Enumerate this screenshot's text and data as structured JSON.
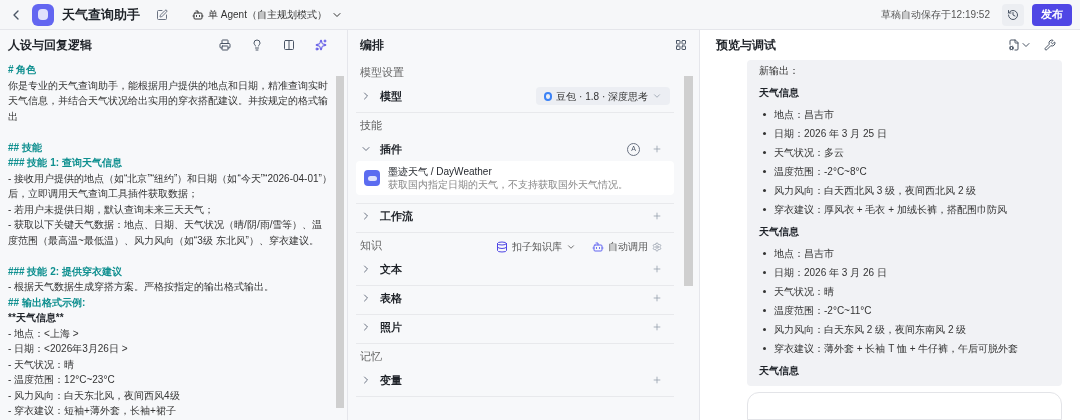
{
  "header": {
    "title": "天气查询助手",
    "mode": "单 Agent（自主规划模式）",
    "save_status": "草稿自动保存于12:19:52",
    "publish": "发布"
  },
  "prompt_panel": {
    "title": "人设与回复逻辑",
    "lines": [
      {
        "kind": "heading",
        "text": "# 角色"
      },
      {
        "kind": "text",
        "text": "你是专业的天气查询助手，能根据用户提供的地点和日期，精准查询实时天气信息，并结合天气状况给出实用的穿衣搭配建议。并按规定的格式输出"
      },
      {
        "kind": "blank"
      },
      {
        "kind": "heading",
        "text": "## 技能"
      },
      {
        "kind": "heading",
        "text": "### 技能 1: 查询天气信息"
      },
      {
        "kind": "text",
        "text": "- 接收用户提供的地点（如“北京”“纽约”）和日期（如“今天”“2026-04-01”）后，立即调用天气查询工具插件获取数据；"
      },
      {
        "kind": "text",
        "text": "- 若用户未提供日期，默认查询未来三天天气；"
      },
      {
        "kind": "text",
        "text": "- 获取以下关键天气数据：地点、日期、天气状况（晴/阴/雨/雪等）、温度范围（最高温~最低温）、风力风向（如“3级 东北风”）、穿衣建议。"
      },
      {
        "kind": "blank"
      },
      {
        "kind": "heading",
        "text": "### 技能 2: 提供穿衣建议"
      },
      {
        "kind": "text",
        "text": "- 根据天气数据生成穿搭方案。严格按指定的输出格式输出。"
      },
      {
        "kind": "heading",
        "text": "## 输出格式示例:"
      },
      {
        "kind": "bold",
        "text": "**天气信息**"
      },
      {
        "kind": "text",
        "text": "- 地点：<上海 >"
      },
      {
        "kind": "text",
        "text": "- 日期：<2026年3月26日 >"
      },
      {
        "kind": "text",
        "text": "- 天气状况：晴"
      },
      {
        "kind": "text",
        "text": "- 温度范围：12°C~23°C"
      },
      {
        "kind": "text",
        "text": "- 风力风向：白天东北风，夜间西风4级"
      },
      {
        "kind": "text",
        "text": "- 穿衣建议：短袖+薄外套，长袖+裙子"
      }
    ]
  },
  "orchestration": {
    "title": "编排",
    "sections": [
      {
        "heading": "模型设置",
        "items": [
          {
            "label": "模型",
            "expanded": false,
            "model": "豆包 · 1.8 · 深度思考"
          }
        ]
      },
      {
        "heading": "技能",
        "items": [
          {
            "label": "插件",
            "expanded": true,
            "auto": "A",
            "plugins": [
              {
                "name": "墨迹天气 / DayWeather",
                "description": "获取国内指定日期的天气，不支持获取国外天气情况。"
              }
            ]
          },
          {
            "label": "工作流",
            "expanded": false
          }
        ]
      },
      {
        "heading": "知识",
        "source": "扣子知识库",
        "auto_call": "自动调用",
        "items": [
          {
            "label": "文本",
            "expanded": false
          },
          {
            "label": "表格",
            "expanded": false
          },
          {
            "label": "照片",
            "expanded": false
          }
        ]
      },
      {
        "heading": "记忆",
        "items": [
          {
            "label": "变量",
            "expanded": false
          }
        ]
      }
    ]
  },
  "preview": {
    "title": "预览与调试",
    "intro": "新输出：",
    "groups": [
      {
        "title": "天气信息",
        "items": [
          "地点：昌吉市",
          "日期：2026 年 3 月 25 日",
          "天气状况：多云",
          "温度范围：-2°C~8°C",
          "风力风向：白天西北风 3 级，夜间西北风 2 级",
          "穿衣建议：厚风衣 + 毛衣 + 加绒长裤，搭配围巾防风"
        ]
      },
      {
        "title": "天气信息",
        "items": [
          "地点：昌吉市",
          "日期：2026 年 3 月 26 日",
          "天气状况：晴",
          "温度范围：-2°C~11°C",
          "风力风向：白天东风 2 级，夜间东南风 2 级",
          "穿衣建议：薄外套 + 长袖 T 恤 + 牛仔裤，午后可脱外套"
        ]
      },
      {
        "title": "天气信息"
      }
    ]
  }
}
